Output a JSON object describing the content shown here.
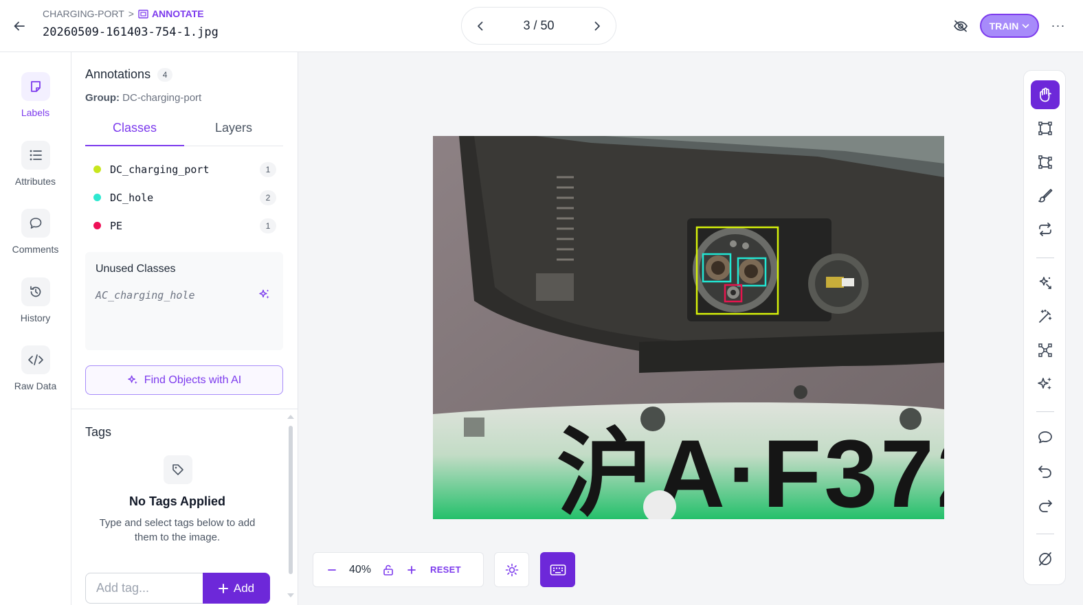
{
  "header": {
    "breadcrumb_project": "CHARGING-PORT",
    "breadcrumb_sep": ">",
    "breadcrumb_mode": "ANNOTATE",
    "filename": "20260509-161403-754-1.jpg",
    "pager": "3 / 50",
    "train_label": "TRAIN",
    "more_label": "···"
  },
  "rail": [
    {
      "label": "Labels",
      "icon": "label-icon",
      "active": true
    },
    {
      "label": "Attributes",
      "icon": "list-icon",
      "active": false
    },
    {
      "label": "Comments",
      "icon": "comment-icon",
      "active": false
    },
    {
      "label": "History",
      "icon": "history-icon",
      "active": false
    },
    {
      "label": "Raw Data",
      "icon": "code-icon",
      "active": false
    }
  ],
  "panel": {
    "title": "Annotations",
    "count": "4",
    "group_label": "Group:",
    "group_value": "DC-charging-port",
    "tabs": [
      "Classes",
      "Layers"
    ],
    "classes": [
      {
        "name": "DC_charging_port",
        "count": "1",
        "color": "#c8e61e"
      },
      {
        "name": "DC_hole",
        "count": "2",
        "color": "#2ee8d0"
      },
      {
        "name": "PE",
        "count": "1",
        "color": "#ee1157"
      }
    ],
    "unused_title": "Unused Classes",
    "unused_classes": [
      "AC_charging_hole"
    ],
    "find_ai": "Find Objects with AI"
  },
  "tags": {
    "title": "Tags",
    "empty_title": "No Tags Applied",
    "empty_desc": "Type and select tags below to add them to the image.",
    "input_placeholder": "Add tag...",
    "add_label": "Add"
  },
  "toolbar": {
    "zoom": "40%",
    "reset": "RESET"
  },
  "colors": {
    "accent": "#7c3aed",
    "accent_dark": "#6d28d9",
    "box_port": "#d7f20a",
    "box_hole": "#22e6d3",
    "box_pe": "#e5154e"
  },
  "tools": [
    "hand-icon",
    "bounding-box-icon",
    "polygon-icon",
    "brush-icon",
    "convert-icon",
    "smart-select-icon",
    "magic-wand-icon",
    "keypoint-icon",
    "ai-sparkle-icon",
    "comment-icon",
    "undo-icon",
    "redo-icon",
    "hide-icon"
  ]
}
